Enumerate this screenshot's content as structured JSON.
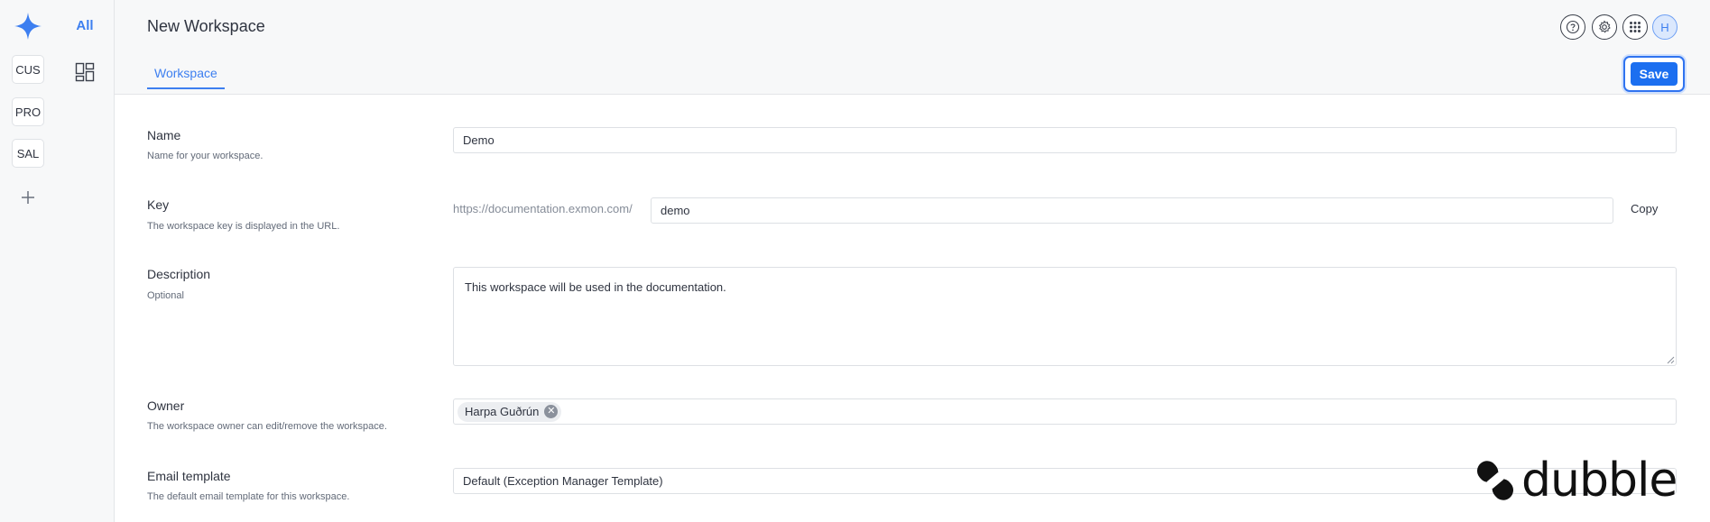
{
  "rail": {
    "items": [
      {
        "label": "CUS"
      },
      {
        "label": "PRO"
      },
      {
        "label": "SAL"
      }
    ],
    "logo_icon": "sparkle-logo",
    "add_icon": "plus-icon",
    "accent": "#3d7ff0"
  },
  "sidebar2": {
    "all_label": "All",
    "grid_icon": "dashboard-grid-icon"
  },
  "header": {
    "title": "New Workspace",
    "tabs": [
      {
        "label": "Workspace",
        "active": true
      }
    ],
    "icons": [
      "help-icon",
      "settings-icon",
      "apps-grid-icon"
    ],
    "avatar_initial": "H",
    "save_label": "Save"
  },
  "form": {
    "name": {
      "label": "Name",
      "help": "Name for your workspace.",
      "value": "Demo"
    },
    "key": {
      "label": "Key",
      "help": "The workspace key is displayed in the URL.",
      "prefix": "https://documentation.exmon.com/",
      "value": "demo",
      "copy_label": "Copy"
    },
    "description": {
      "label": "Description",
      "help": "Optional",
      "value": "This workspace will be used in the documentation."
    },
    "owner": {
      "label": "Owner",
      "help": "The workspace owner can edit/remove the workspace.",
      "chip": "Harpa Guðrún"
    },
    "email_template": {
      "label": "Email template",
      "help": "The default email template for this workspace.",
      "value": "Default (Exception Manager Template)"
    }
  },
  "watermark": {
    "text": "dubble"
  }
}
